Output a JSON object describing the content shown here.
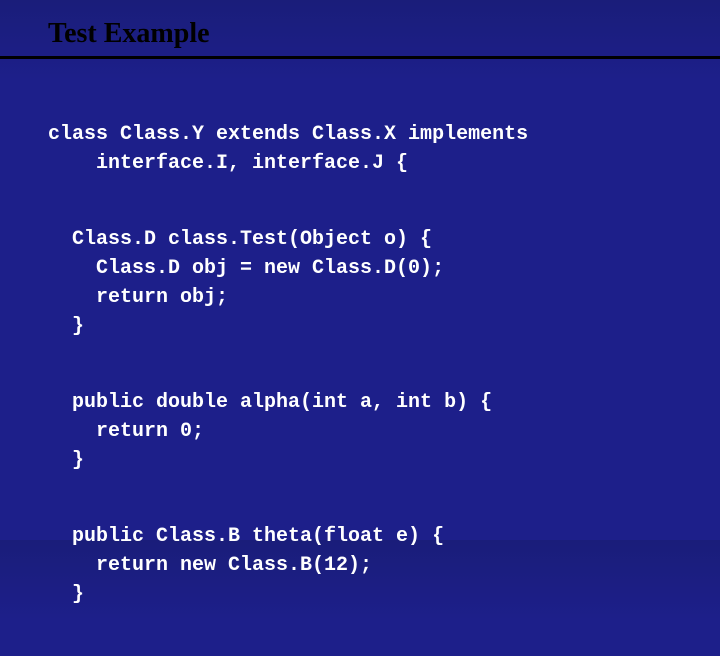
{
  "slide": {
    "title": "Test Example"
  },
  "code": {
    "decl1": "class Class.Y extends Class.X implements",
    "decl2": "    interface.I, interface.J {",
    "method1_1": "  Class.D class.Test(Object o) {",
    "method1_2": "    Class.D obj = new Class.D(0);",
    "method1_3": "    return obj;",
    "method1_4": "  }",
    "method2_1": "  public double alpha(int a, int b) {",
    "method2_2": "    return 0;",
    "method2_3": "  }",
    "method3_1": "  public Class.B theta(float e) {",
    "method3_2": "    return new Class.B(12);",
    "method3_3": "  }"
  }
}
